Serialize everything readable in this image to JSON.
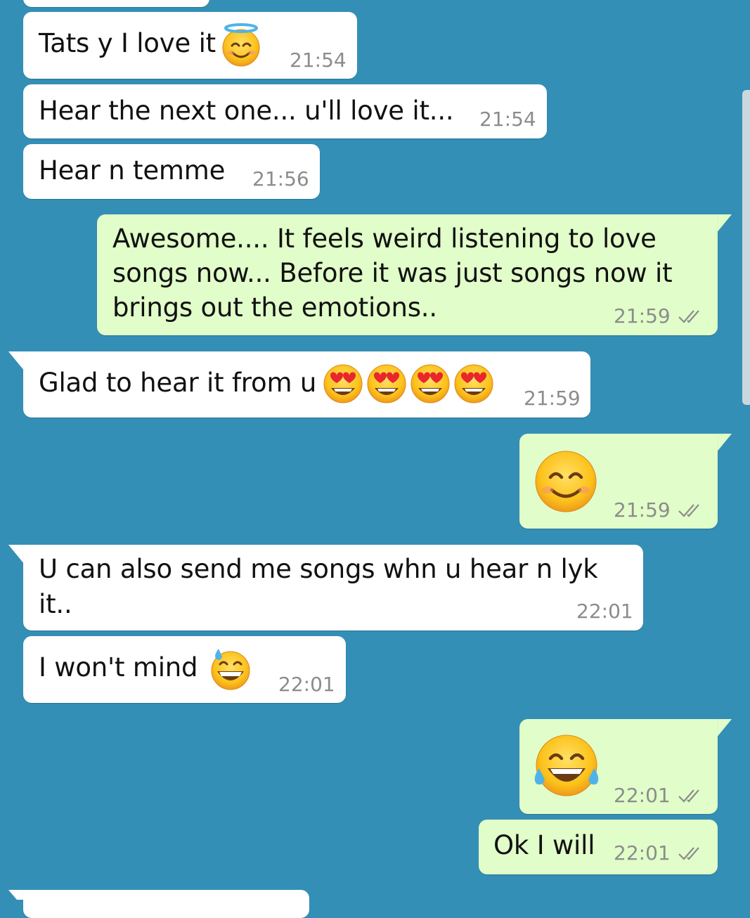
{
  "colors": {
    "background": "#348fb6",
    "incoming": "#ffffff",
    "outgoing": "#e1fdc9",
    "time": "#8c8c8c",
    "ticks": "#8c8c8c"
  },
  "messages": [
    {
      "text": "Tats y I love it",
      "emoji": "smiling-face-with-halo-icon",
      "time": "21:54",
      "dir": "in"
    },
    {
      "text": "Hear the next one... u'll love it...",
      "time": "21:54",
      "dir": "in"
    },
    {
      "text": "Hear n temme",
      "time": "21:56",
      "dir": "in"
    },
    {
      "lines": [
        "Awesome.... It feels weird listening to love",
        "songs now... Before it was just songs now it",
        "brings out the emotions.."
      ],
      "time": "21:59",
      "dir": "out",
      "status": "double-check-icon"
    },
    {
      "text": "Glad to hear it from u",
      "emoji": "heart-eyes-face-icon x4",
      "time": "21:59",
      "dir": "in"
    },
    {
      "emoji": "smiling-face-icon",
      "time": "21:59",
      "dir": "out",
      "status": "double-check-icon"
    },
    {
      "lines": [
        "U can also send me songs whn u hear n lyk",
        "it.."
      ],
      "time": "22:01",
      "dir": "in"
    },
    {
      "text": "I won't mind",
      "emoji": "grinning-sweat-face-icon",
      "time": "22:01",
      "dir": "in"
    },
    {
      "emoji": "tears-of-joy-face-icon",
      "time": "22:01",
      "dir": "out",
      "status": "double-check-icon"
    },
    {
      "text": "Ok I will",
      "time": "22:01",
      "dir": "out",
      "status": "double-check-icon"
    }
  ]
}
